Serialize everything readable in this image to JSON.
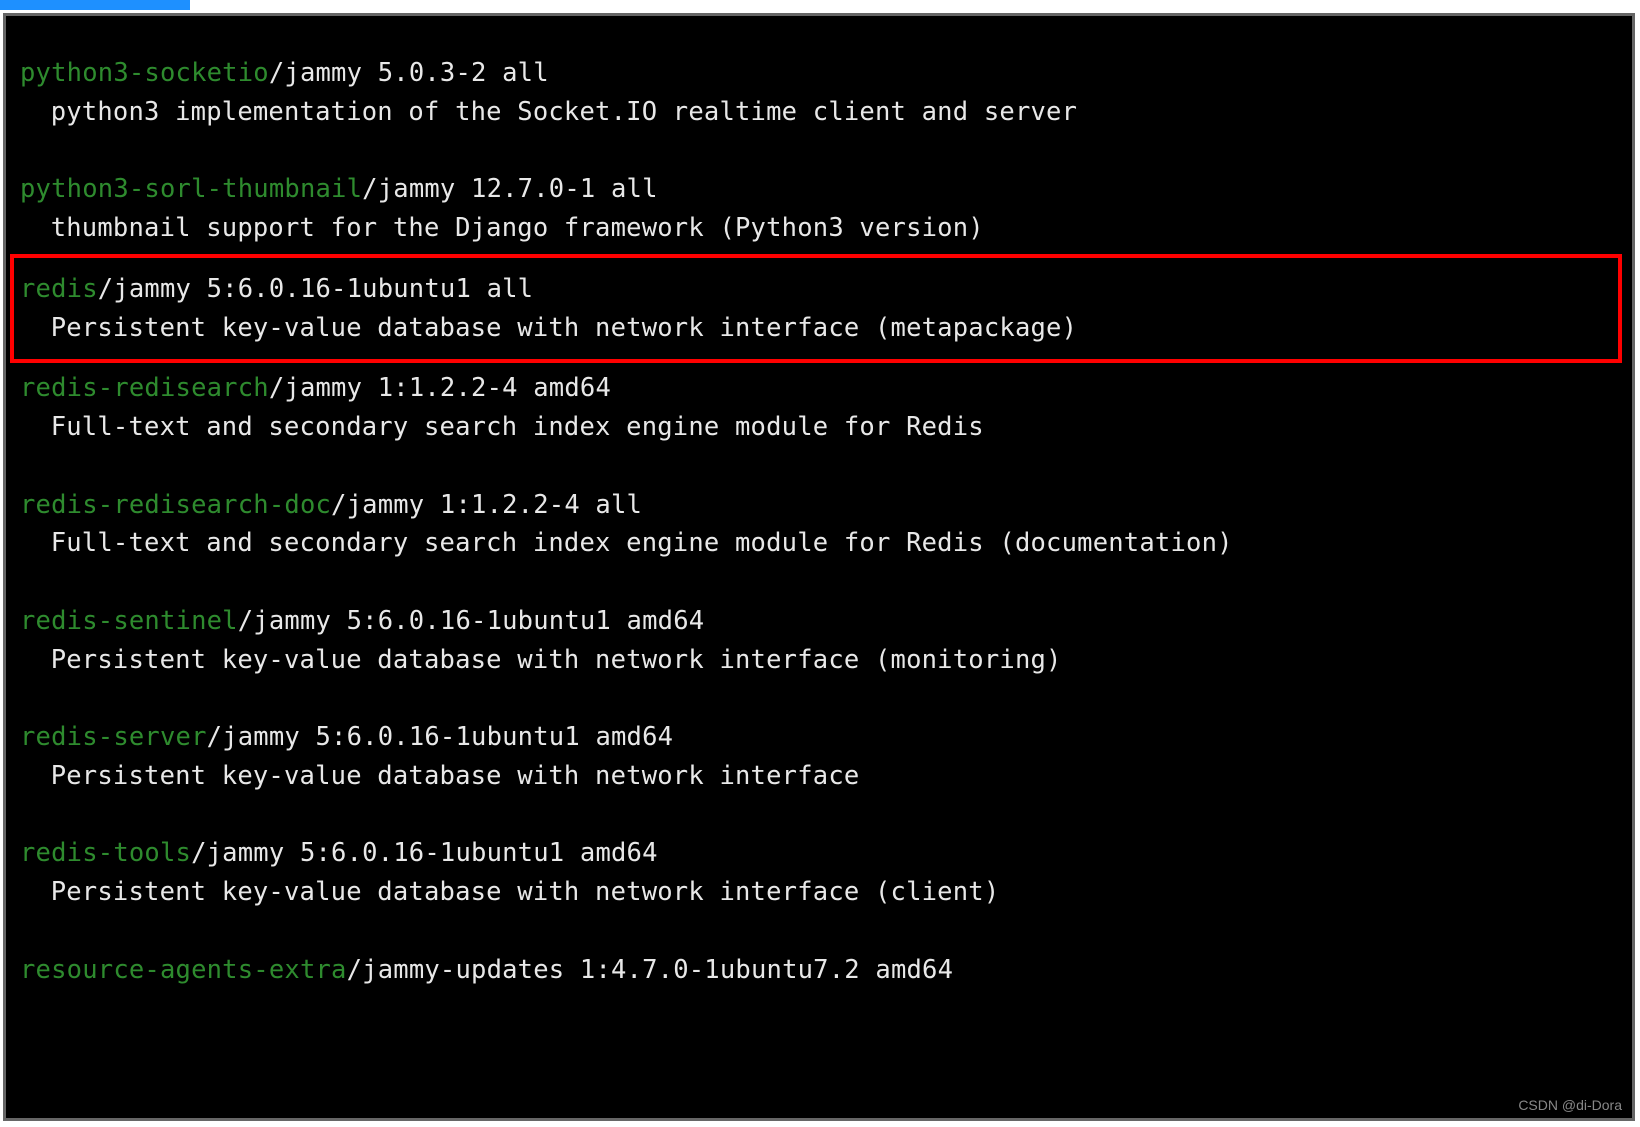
{
  "packages": [
    {
      "name": "python3-socketio",
      "suffix": "/jammy 5.0.3-2 all",
      "desc": "python3 implementation of the Socket.IO realtime client and server",
      "highlighted": false
    },
    {
      "name": "python3-sorl-thumbnail",
      "suffix": "/jammy 12.7.0-1 all",
      "desc": "thumbnail support for the Django framework (Python3 version)",
      "highlighted": false
    },
    {
      "name": "redis",
      "suffix": "/jammy 5:6.0.16-1ubuntu1 all",
      "desc": "Persistent key-value database with network interface (metapackage)",
      "highlighted": true
    },
    {
      "name": "redis-redisearch",
      "suffix": "/jammy 1:1.2.2-4 amd64",
      "desc": "Full-text and secondary search index engine module for Redis",
      "highlighted": false
    },
    {
      "name": "redis-redisearch-doc",
      "suffix": "/jammy 1:1.2.2-4 all",
      "desc": "Full-text and secondary search index engine module for Redis (documentation)",
      "highlighted": false
    },
    {
      "name": "redis-sentinel",
      "suffix": "/jammy 5:6.0.16-1ubuntu1 amd64",
      "desc": "Persistent key-value database with network interface (monitoring)",
      "highlighted": false
    },
    {
      "name": "redis-server",
      "suffix": "/jammy 5:6.0.16-1ubuntu1 amd64",
      "desc": "Persistent key-value database with network interface",
      "highlighted": false
    },
    {
      "name": "redis-tools",
      "suffix": "/jammy 5:6.0.16-1ubuntu1 amd64",
      "desc": "Persistent key-value database with network interface (client)",
      "highlighted": false
    },
    {
      "name": "resource-agents-extra",
      "suffix": "/jammy-updates 1:4.7.0-1ubuntu7.2 amd64",
      "desc": "",
      "highlighted": false
    }
  ],
  "watermark": "CSDN @di-Dora"
}
